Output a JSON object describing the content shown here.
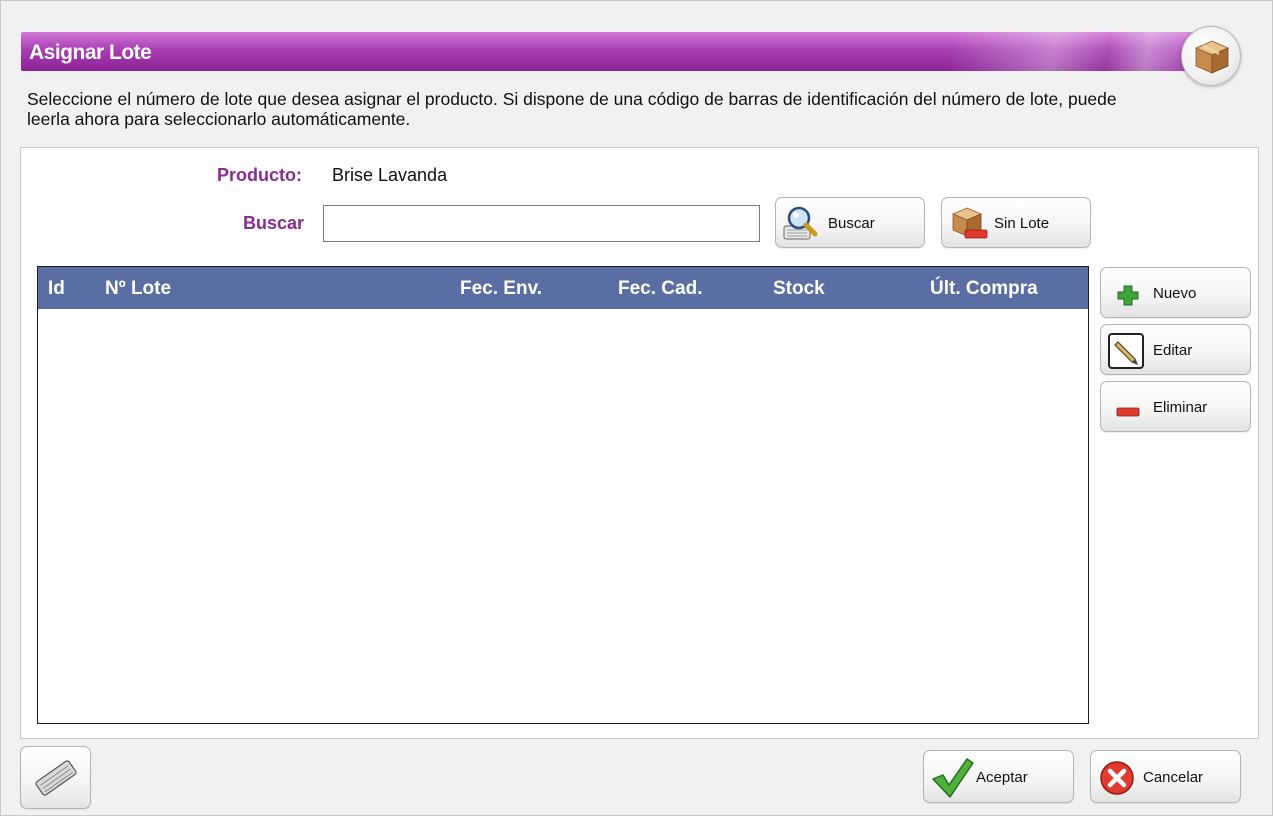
{
  "window": {
    "title": "Asignar Lote",
    "instructions": "Seleccione el número de lote que desea asignar el producto.  Si dispone de una código de barras de identificación del número de lote, puede leerla ahora para seleccionarlo automáticamente."
  },
  "form": {
    "producto_label": "Producto:",
    "producto_value": "Brise Lavanda",
    "buscar_label": "Buscar",
    "buscar_value": "",
    "buscar_button": "Buscar",
    "sin_lote_button": "Sin Lote"
  },
  "table": {
    "columns": [
      "Id",
      "Nº Lote",
      "Fec. Env.",
      "Fec. Cad.",
      "Stock",
      "Últ. Compra"
    ],
    "rows": []
  },
  "side_actions": {
    "nuevo": "Nuevo",
    "editar": "Editar",
    "eliminar": "Eliminar"
  },
  "footer": {
    "aceptar": "Aceptar",
    "cancelar": "Cancelar"
  },
  "colors": {
    "title_bar": "#a83fb4",
    "label_purple": "#8a2b95",
    "grid_header": "#5a6ea4"
  },
  "icons": {
    "corner": "package-box-icon",
    "buscar": "magnifier-keyboard-icon",
    "sin_lote": "package-minus-icon",
    "nuevo": "green-plus-icon",
    "editar": "pencil-edit-icon",
    "eliminar": "red-minus-icon",
    "keyboard": "keyboard-icon",
    "aceptar": "green-check-icon",
    "cancelar": "red-x-circle-icon"
  }
}
